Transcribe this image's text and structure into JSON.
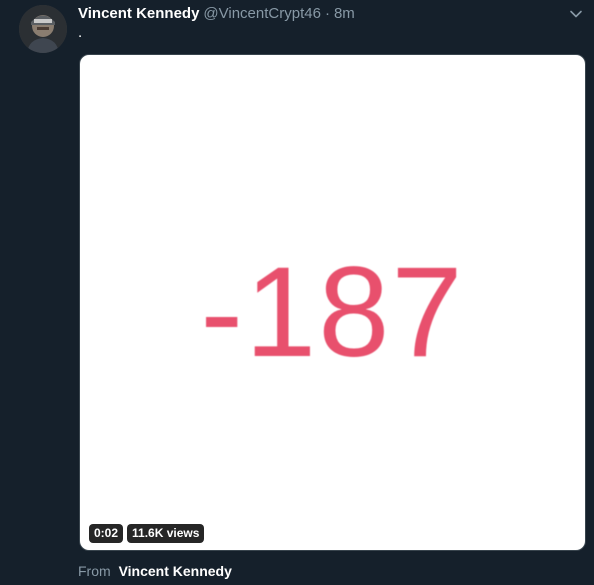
{
  "tweet": {
    "author": {
      "display_name": "Vincent Kennedy",
      "handle": "@VincentCrypt46",
      "separator": "·",
      "time": "8m"
    },
    "text": ".",
    "media": {
      "content_text": "-187",
      "content_color": "#e8506d",
      "duration": "0:02",
      "views": "11.6K views"
    },
    "source": {
      "prefix": "From",
      "name": "Vincent Kennedy"
    },
    "menu_icon": "chevron-down-icon"
  },
  "colors": {
    "background": "#15202b",
    "secondary_text": "#8899a6",
    "primary_text": "#ffffff"
  }
}
